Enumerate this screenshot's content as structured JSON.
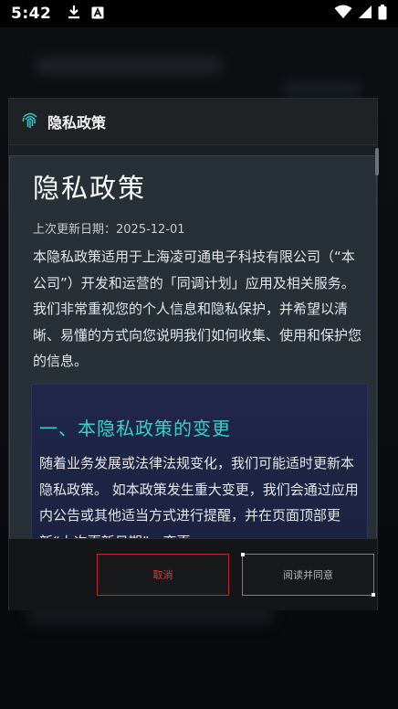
{
  "status_bar": {
    "time": "5:42",
    "icons": [
      "download-icon",
      "font-a-icon",
      "wifi-icon",
      "signal-icon",
      "battery-icon"
    ]
  },
  "dialog": {
    "title": "隐私政策",
    "title_icon": "fingerprint-icon",
    "document": {
      "heading": "隐私政策",
      "updated": "上次更新日期：2025-12-01",
      "intro": "本隐私政策适用于上海凌可通电子科技有限公司（“本公司”）开发和运营的「同调计划」应用及相关服务。 我们非常重视您的个人信息和隐私保护，并希望以清晰、易懂的方式向您说明我们如何收集、使用和保护您的信息。",
      "section": {
        "title": "一、本隐私政策的变更",
        "body": "随着业务发展或法律法规变化，我们可能适时更新本隐私政策。 如本政策发生重大变更，我们会通过应用内公告或其他适当方式进行提醒，并在页面顶部更新“上次更新日期”。变更"
      }
    },
    "buttons": {
      "cancel": "取消",
      "agree": "阅读并同意"
    }
  },
  "colors": {
    "accent_teal": "#39d0cc",
    "cancel_red": "#e0393e"
  }
}
